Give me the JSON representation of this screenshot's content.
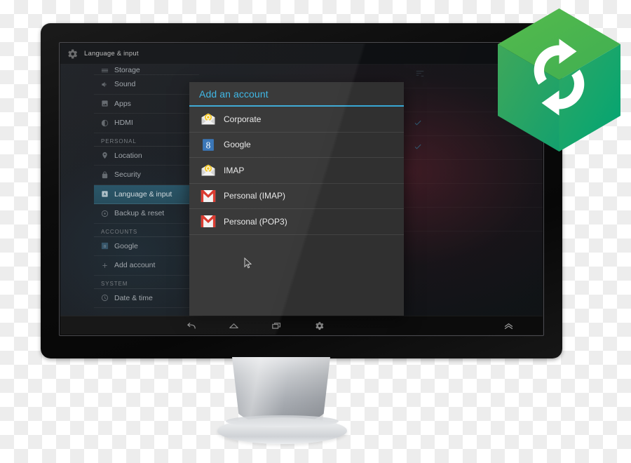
{
  "device": {
    "type": "desktop-monitor",
    "screen_label": "android-tablet-settings"
  },
  "system_bar": {
    "icon": "gear-icon",
    "title": "Language & input"
  },
  "settings_sidebar": {
    "items": [
      {
        "label": "Storage",
        "icon": "storage-icon",
        "type": "item",
        "selected": false,
        "clipped": true
      },
      {
        "label": "Sound",
        "icon": "sound-icon",
        "type": "item",
        "selected": false
      },
      {
        "label": "Apps",
        "icon": "apps-icon",
        "type": "item",
        "selected": false
      },
      {
        "label": "HDMI",
        "icon": "hdmi-icon",
        "type": "item",
        "selected": false
      },
      {
        "label": "PERSONAL",
        "icon": "",
        "type": "header"
      },
      {
        "label": "Location",
        "icon": "location-icon",
        "type": "item",
        "selected": false
      },
      {
        "label": "Security",
        "icon": "lock-icon",
        "type": "item",
        "selected": false
      },
      {
        "label": "Language & input",
        "icon": "language-icon",
        "type": "item",
        "selected": true
      },
      {
        "label": "Backup & reset",
        "icon": "backup-icon",
        "type": "item",
        "selected": false
      },
      {
        "label": "ACCOUNTS",
        "icon": "",
        "type": "header"
      },
      {
        "label": "Google",
        "icon": "google-icon",
        "type": "item",
        "selected": false
      },
      {
        "label": "Add account",
        "icon": "plus-icon",
        "type": "item",
        "selected": false
      },
      {
        "label": "SYSTEM",
        "icon": "",
        "type": "header"
      },
      {
        "label": "Date & time",
        "icon": "clock-icon",
        "type": "item",
        "selected": false
      }
    ]
  },
  "dialog": {
    "title": "Add an account",
    "accent_color": "#33b5e5",
    "background_color": "#2e2e2e",
    "items": [
      {
        "label": "Corporate",
        "icon": "corporate-mail-icon"
      },
      {
        "label": "Google",
        "icon": "google-g-icon"
      },
      {
        "label": "IMAP",
        "icon": "imap-mail-icon"
      },
      {
        "label": "Personal (IMAP)",
        "icon": "gmail-icon"
      },
      {
        "label": "Personal (POP3)",
        "icon": "gmail-icon"
      }
    ]
  },
  "nav_bar": {
    "buttons": [
      {
        "name": "back-icon",
        "label": "Back"
      },
      {
        "name": "home-icon",
        "label": "Home"
      },
      {
        "name": "recents-icon",
        "label": "Recent apps"
      },
      {
        "name": "settings-icon",
        "label": "Settings"
      }
    ],
    "expand_button": {
      "name": "expand-up-icon",
      "label": "Show navigation"
    }
  },
  "logo": {
    "name": "sync-cube-logo",
    "colors": {
      "top": "#4caf50",
      "left": "#3fa65c",
      "right": "#00a06b",
      "arrow": "#ffffff"
    }
  },
  "cursor": {
    "name": "mouse-pointer"
  }
}
